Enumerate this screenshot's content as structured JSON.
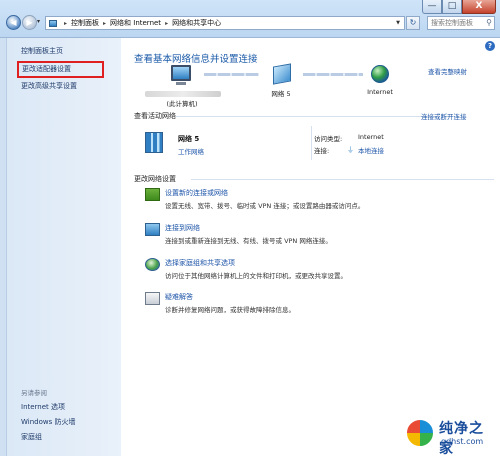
{
  "window": {
    "minimize": "—",
    "maximize": "□",
    "close": "X"
  },
  "addressbar": {
    "crumbs": [
      "控制面板",
      "网络和 Internet",
      "网络和共享中心"
    ],
    "separator": "▸",
    "icon_name": "network-folder-icon"
  },
  "search": {
    "placeholder": "搜索控制面板"
  },
  "left_pane": {
    "links": [
      {
        "label": "控制面板主页"
      },
      {
        "label": "更改适配器设置",
        "highlighted": true
      },
      {
        "label": "更改高级共享设置"
      }
    ],
    "see_also_title": "另请参阅",
    "see_also": [
      "Internet 选项",
      "Windows 防火墙",
      "家庭组"
    ]
  },
  "main": {
    "title": "查看基本网络信息并设置连接",
    "full_map_link": "查看完整映射",
    "map": {
      "computer_label": "(此计算机)",
      "network_label": "网络 5",
      "internet_label": "Internet"
    },
    "active_networks_header": "查看活动网络",
    "connect_disconnect_link": "连接或断开连接",
    "network": {
      "name": "网络 5",
      "type": "工作网络",
      "access_type_label": "访问类型:",
      "access_type_value": "Internet",
      "connections_label": "连接:",
      "connections_value": "本地连接"
    },
    "change_settings_header": "更改网络设置",
    "tasks": [
      {
        "icon": "new-connection-icon",
        "label": "设置新的连接或网络",
        "desc": "设置无线、宽带、拨号、临时或 VPN 连接；或设置路由器或访问点。"
      },
      {
        "icon": "connect-network-icon",
        "label": "连接到网络",
        "desc": "连接到或重新连接到无线、有线、拨号或 VPN 网络连接。"
      },
      {
        "icon": "homegroup-icon",
        "label": "选择家庭组和共享选项",
        "desc": "访问位于其他网络计算机上的文件和打印机，或更改共享设置。"
      },
      {
        "icon": "troubleshoot-icon",
        "label": "疑难解答",
        "desc": "诊断并修复网络问题，或获得故障排除信息。"
      }
    ]
  },
  "watermark": {
    "name": "纯净之家",
    "url": "gdhst.com"
  }
}
